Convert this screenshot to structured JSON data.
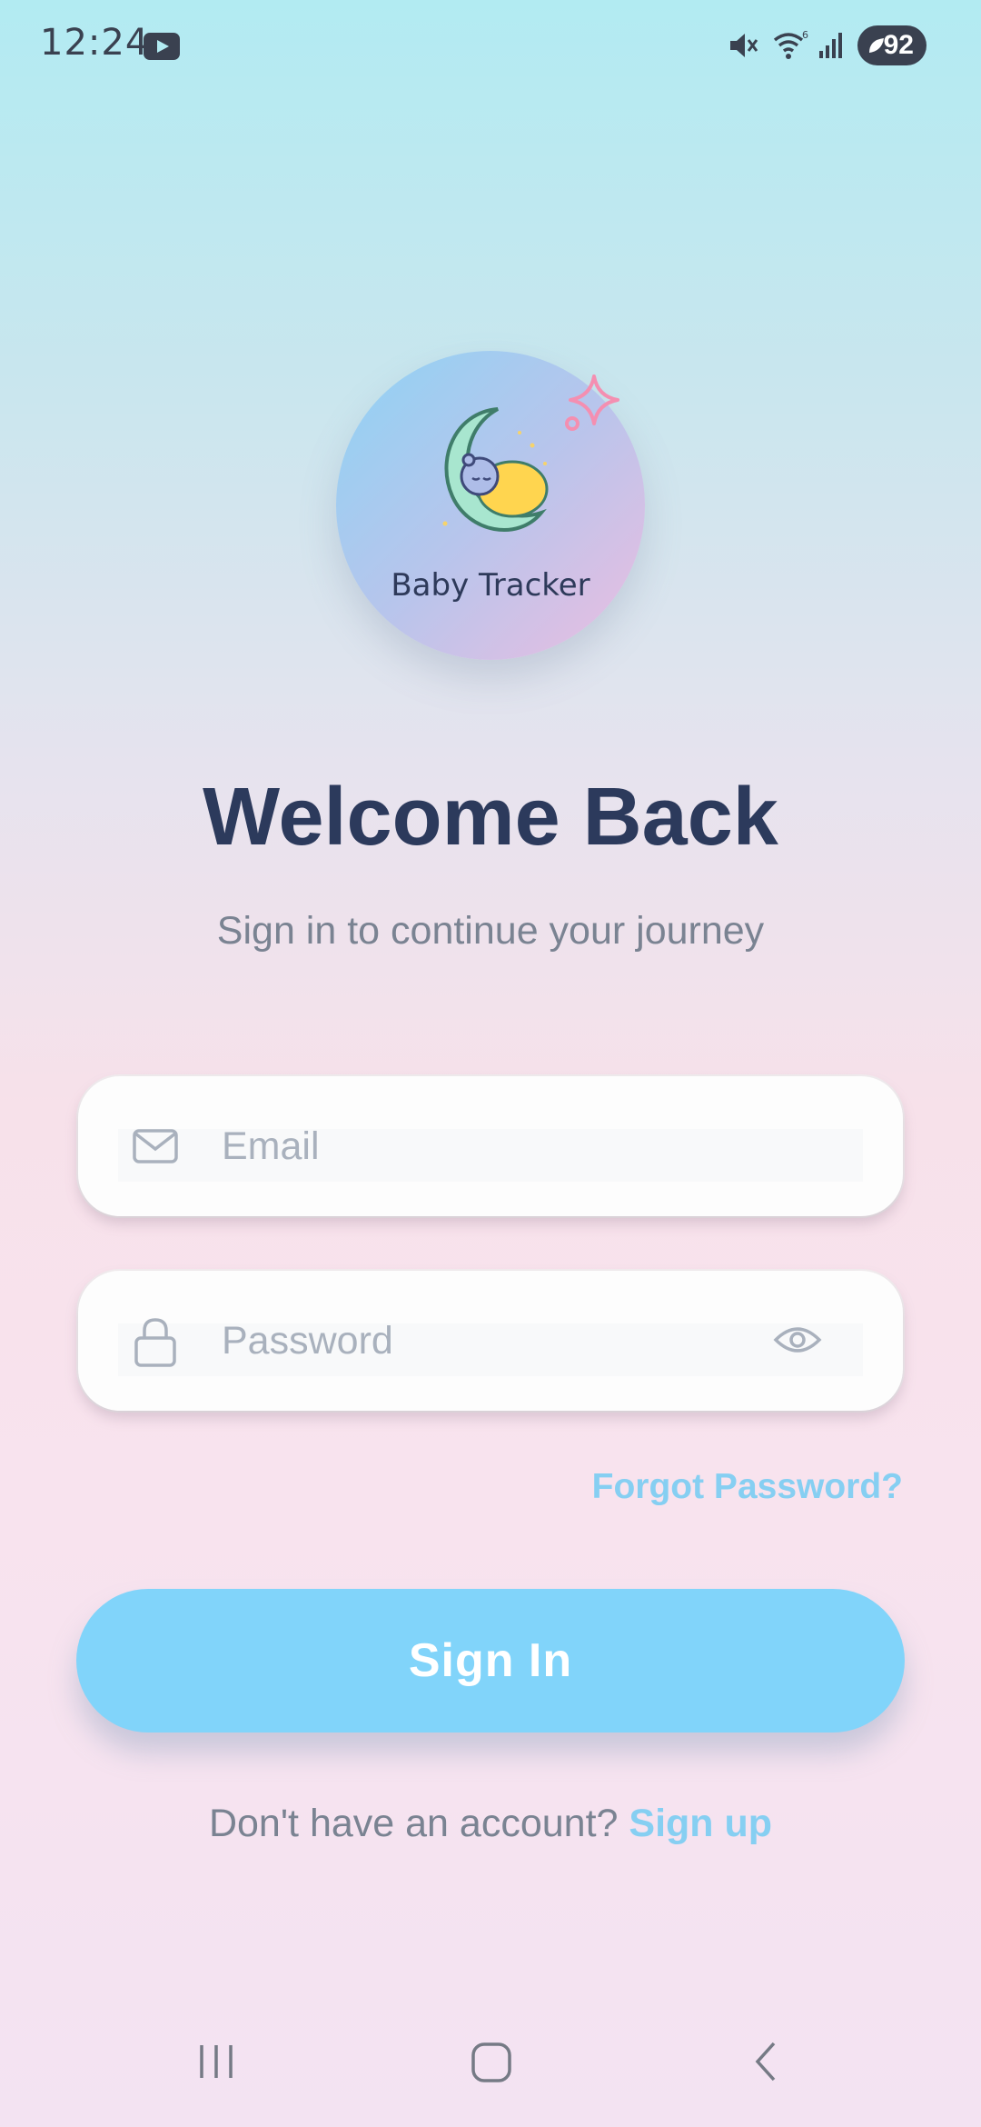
{
  "status_bar": {
    "time": "12:24",
    "battery": "92",
    "icons": [
      "youtube-icon",
      "mute-icon",
      "wifi-icon",
      "signal-icon",
      "battery-icon"
    ]
  },
  "logo": {
    "name": "Baby Tracker",
    "icon": "baby-moon-icon"
  },
  "header": {
    "title": "Welcome Back",
    "subtitle": "Sign in to continue your journey"
  },
  "form": {
    "email": {
      "placeholder": "Email",
      "value": "",
      "icon": "mail-icon"
    },
    "password": {
      "placeholder": "Password",
      "value": "",
      "icon": "lock-icon",
      "toggle_icon": "eye-icon"
    },
    "forgot_label": "Forgot Password?",
    "submit_label": "Sign In"
  },
  "footer": {
    "prompt": "Don't have an account?",
    "signup_label": "Sign up"
  },
  "nav_bar": {
    "items": [
      "recent-apps-icon",
      "home-icon",
      "back-icon"
    ]
  },
  "colors": {
    "accent": "#81d4fa",
    "title": "#2c3a5c",
    "muted": "#7a8392"
  }
}
